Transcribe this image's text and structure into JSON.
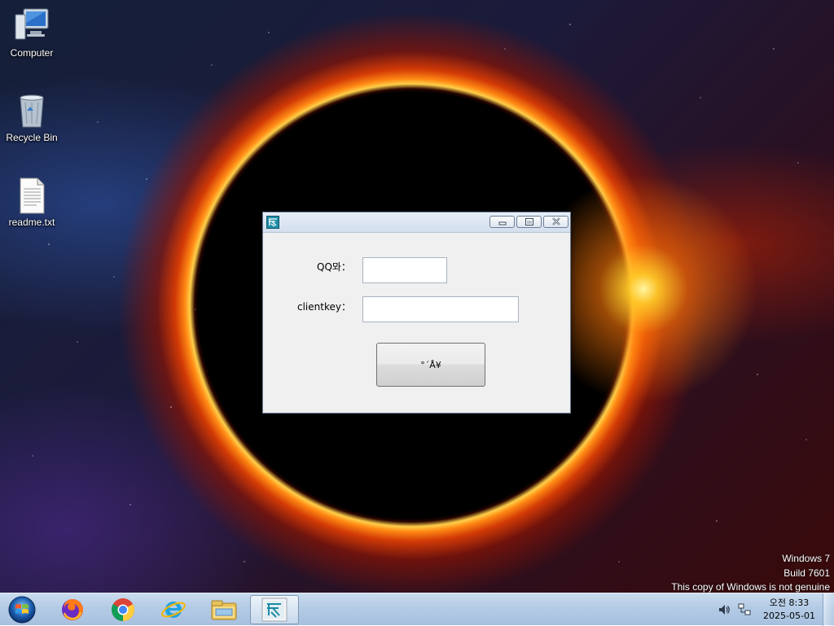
{
  "desktop": {
    "icons": [
      {
        "label": "Computer",
        "icon": "computer-icon"
      },
      {
        "label": "Recycle Bin",
        "icon": "recycle-bin-icon"
      },
      {
        "label": "readme.txt",
        "icon": "text-file-icon"
      }
    ]
  },
  "window": {
    "title": "",
    "qq_label": "QQ뫄：",
    "qq_value": "",
    "clientkey_label": "clientkey：",
    "clientkey_value": "",
    "submit_label": "°´Å¥",
    "caption_buttons": [
      "minimize",
      "maximize",
      "close"
    ]
  },
  "watermark": {
    "line1": "Windows 7",
    "line2": "Build 7601",
    "line3": "This copy of Windows is not genuine"
  },
  "taskbar": {
    "pinned": [
      "start-orb-icon",
      "firefox-icon",
      "chrome-icon",
      "internet-explorer-icon",
      "file-explorer-icon",
      "app-window-icon"
    ],
    "clock_time": "오전 8:33",
    "clock_date": "2025-05-01",
    "tray": [
      "volume-icon",
      "network-icon"
    ]
  },
  "colors": {
    "taskbar": "#b4cbe5",
    "window_bg": "#f0f0f0",
    "titlebar": "#dbe5f1"
  }
}
